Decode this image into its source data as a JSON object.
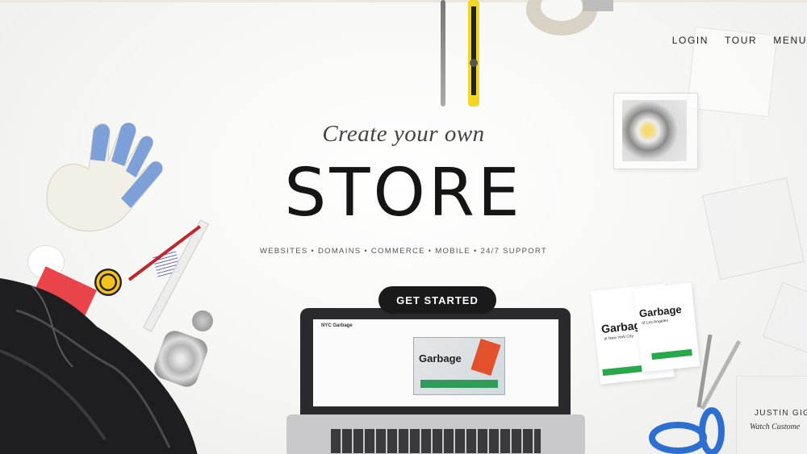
{
  "nav": {
    "items": [
      "LOGIN",
      "TOUR",
      "MENU"
    ]
  },
  "hero": {
    "subtitle": "Create your own",
    "title": "STORE",
    "features": "WEBSITES • DOMAINS • COMMERCE • MOBILE • 24/7 SUPPORT",
    "cta_label": "GET STARTED"
  },
  "laptop_screen": {
    "mini_title": "NYC Garbage",
    "product_label": "Garbage"
  },
  "business_cards": [
    {
      "brand": "Garbage",
      "city": "of New York City"
    },
    {
      "brand": "Garbage",
      "city": "of Los Angeles"
    }
  ],
  "testimonial": {
    "name": "JUSTIN GIG",
    "link": "Watch Custome"
  },
  "colors": {
    "cta_background": "#1a1a1a",
    "cta_text": "#ffffff",
    "title_text": "#151515",
    "brand_green": "#27a94a"
  }
}
